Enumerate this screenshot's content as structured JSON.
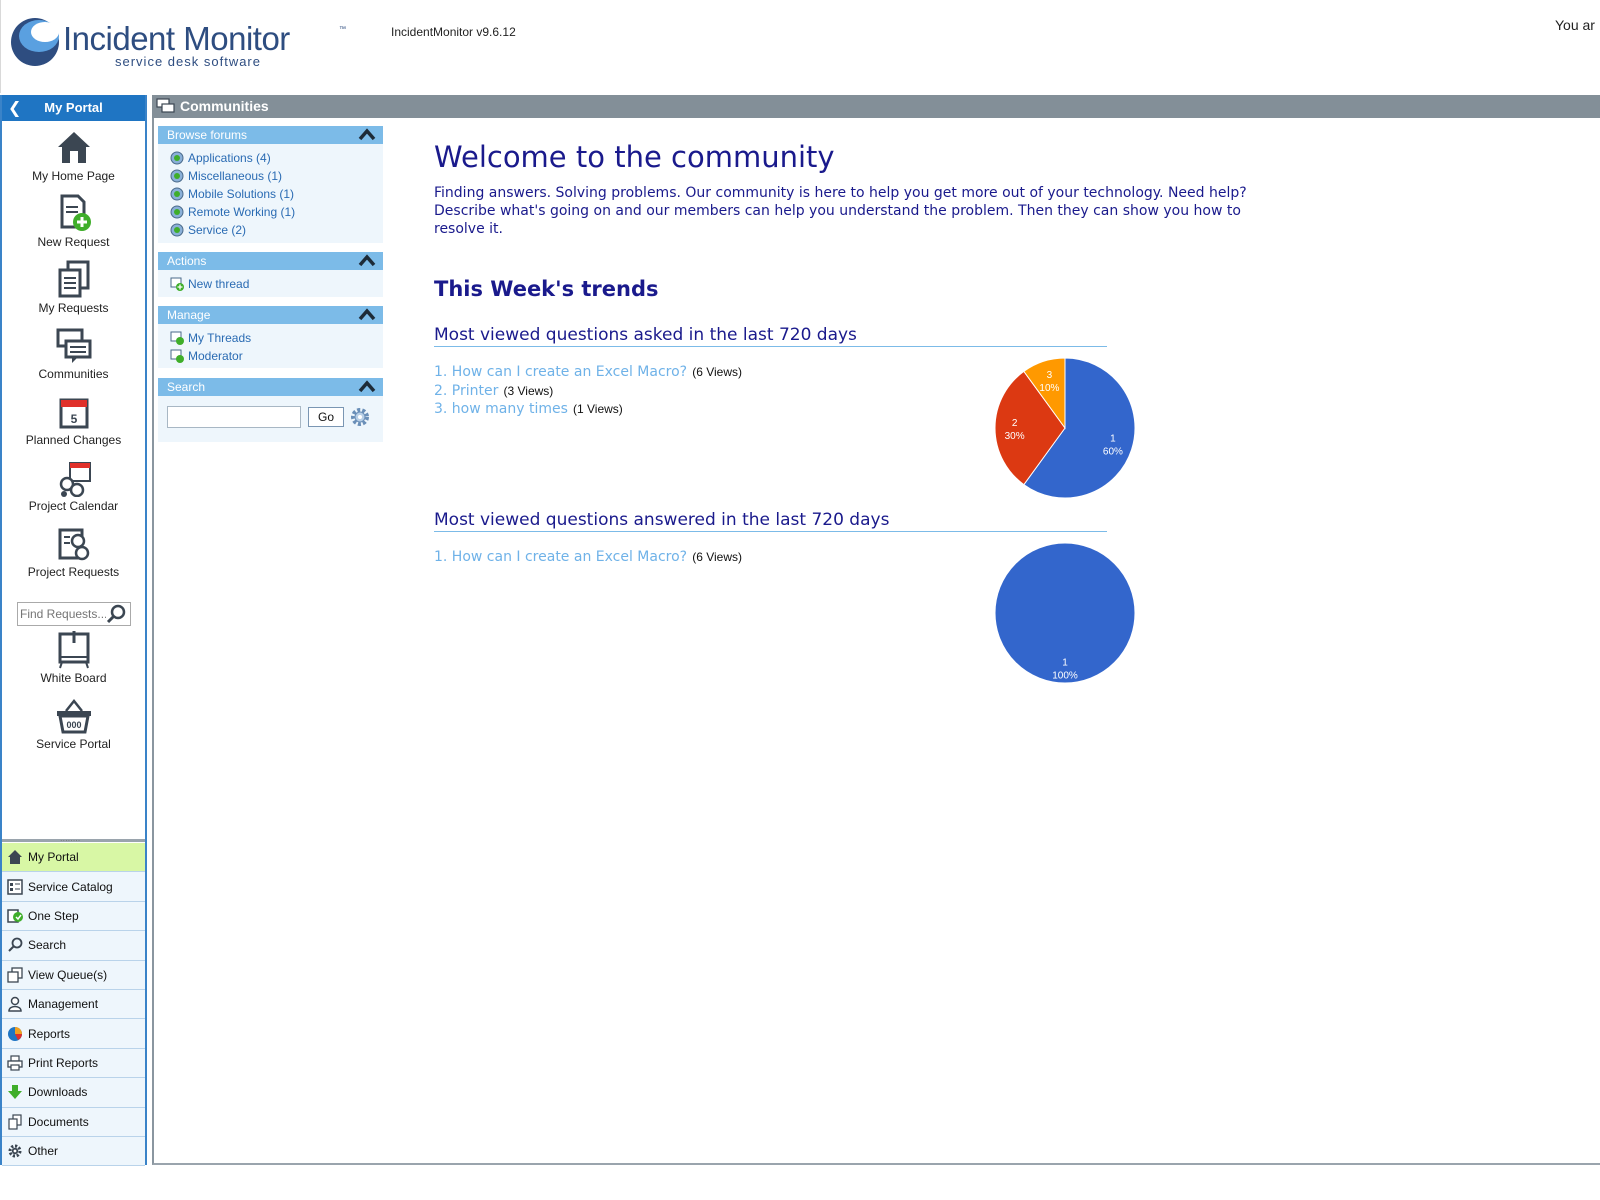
{
  "header": {
    "logo_title": "Incident Monitor",
    "logo_tm": "™",
    "logo_subtitle": "service desk software",
    "version": "IncidentMonitor v9.6.12",
    "user_text": "You ar"
  },
  "sidebar": {
    "title": "My Portal",
    "back_icon": "chevron-left-icon",
    "items": [
      {
        "label": "My Home Page",
        "icon": "home-icon"
      },
      {
        "label": "New Request",
        "icon": "new-request-icon"
      },
      {
        "label": "My Requests",
        "icon": "my-requests-icon"
      },
      {
        "label": "Communities",
        "icon": "communities-icon"
      },
      {
        "label": "Planned Changes",
        "icon": "calendar-icon"
      },
      {
        "label": "Project Calendar",
        "icon": "project-calendar-icon"
      },
      {
        "label": "Project Requests",
        "icon": "project-requests-icon"
      },
      {
        "label": "White Board",
        "icon": "whiteboard-icon"
      },
      {
        "label": "Service Portal",
        "icon": "basket-icon"
      }
    ],
    "find_placeholder": "Find Requests...",
    "splitter_dots": "........",
    "nav": [
      {
        "label": "My Portal",
        "icon": "home-icon",
        "active": true
      },
      {
        "label": "Service Catalog",
        "icon": "catalog-icon"
      },
      {
        "label": "One Step",
        "icon": "one-step-icon"
      },
      {
        "label": "Search",
        "icon": "search-icon"
      },
      {
        "label": "View Queue(s)",
        "icon": "queue-icon"
      },
      {
        "label": "Management",
        "icon": "user-icon"
      },
      {
        "label": "Reports",
        "icon": "pie-chart-icon"
      },
      {
        "label": "Print Reports",
        "icon": "printer-icon"
      },
      {
        "label": "Downloads",
        "icon": "download-icon"
      },
      {
        "label": "Documents",
        "icon": "documents-icon"
      },
      {
        "label": "Other",
        "icon": "gear-icon"
      }
    ]
  },
  "main": {
    "bar_title": "Communities",
    "panels": {
      "browse": {
        "title": "Browse forums",
        "links": [
          "Applications (4)",
          "Miscellaneous (1)",
          "Mobile Solutions (1)",
          "Remote Working (1)",
          "Service (2)"
        ]
      },
      "actions": {
        "title": "Actions",
        "links": [
          "New thread"
        ]
      },
      "manage": {
        "title": "Manage",
        "links": [
          "My Threads",
          "Moderator"
        ]
      },
      "search": {
        "title": "Search",
        "go_label": "Go",
        "value": ""
      }
    },
    "content": {
      "welcome": "Welcome to the community",
      "intro": "Finding answers. Solving problems. Our community is here to help you get more out of your technology. Need help? Describe what's going on and our members can help you understand the problem. Then they can show you how to resolve it.",
      "trends_title": "This Week's trends",
      "asked": {
        "title": "Most viewed questions asked in the last 720 days",
        "questions": [
          {
            "text": "1. How can I create an Excel Macro?",
            "views": "(6 Views)"
          },
          {
            "text": "2. Printer",
            "views": "(3 Views)"
          },
          {
            "text": "3. how many times",
            "views": "(1 Views)"
          }
        ]
      },
      "answered": {
        "title": "Most viewed questions answered in the last 720 days",
        "questions": [
          {
            "text": "1. How can I create an Excel Macro?",
            "views": "(6 Views)"
          }
        ]
      }
    }
  },
  "colors": {
    "accent": "#1f75c3",
    "panel_header": "#7cbbe8",
    "heading": "#1a1a8c",
    "link": "#6fb2e8",
    "active_nav": "#d8f7a5",
    "pie_blue": "#3366cc",
    "pie_red": "#dc3912",
    "pie_orange": "#ff9900"
  },
  "chart_data": [
    {
      "type": "pie",
      "title": "",
      "slices": [
        {
          "label": "1",
          "value": 60,
          "pct": "60%",
          "color": "#3366cc"
        },
        {
          "label": "2",
          "value": 30,
          "pct": "30%",
          "color": "#dc3912"
        },
        {
          "label": "3",
          "value": 10,
          "pct": "10%",
          "color": "#ff9900"
        }
      ]
    },
    {
      "type": "pie",
      "title": "",
      "slices": [
        {
          "label": "1",
          "value": 100,
          "pct": "100%",
          "color": "#3366cc"
        }
      ]
    }
  ]
}
